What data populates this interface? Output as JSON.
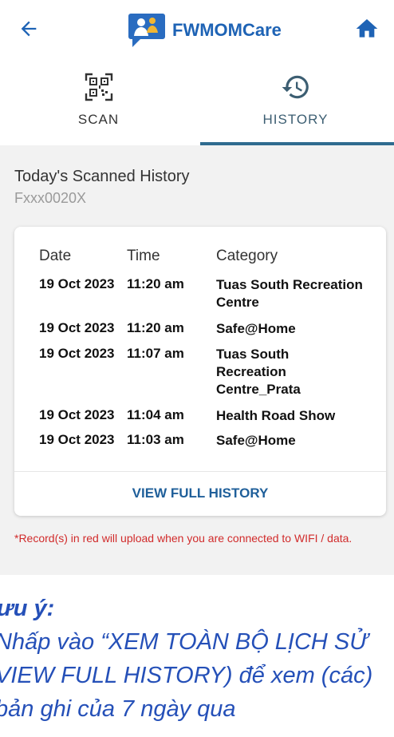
{
  "header": {
    "app_name": "FWMOMCare",
    "back_icon": "arrow-left-icon",
    "home_icon": "home-icon",
    "brand_color": "#1e63b5"
  },
  "tabs": [
    {
      "label": "SCAN",
      "icon": "qr-code-icon",
      "selected": false
    },
    {
      "label": "HISTORY",
      "icon": "history-icon",
      "selected": true
    }
  ],
  "history": {
    "title": "Today's Scanned History",
    "user_id": "Fxxx0020X",
    "columns": {
      "date": "Date",
      "time": "Time",
      "category": "Category"
    },
    "rows": [
      {
        "date": "19 Oct 2023",
        "time": "11:20 am",
        "category": "Tuas South Recreation Centre"
      },
      {
        "date": "19 Oct 2023",
        "time": "11:20 am",
        "category": "Safe@Home"
      },
      {
        "date": "19 Oct 2023",
        "time": "11:07 am",
        "category": "Tuas South Recreation Centre_Prata"
      },
      {
        "date": "19 Oct 2023",
        "time": "11:04 am",
        "category": "Health Road Show"
      },
      {
        "date": "19 Oct 2023",
        "time": "11:03 am",
        "category": "Safe@Home"
      }
    ],
    "view_full_label": "VIEW FULL HISTORY",
    "note": "*Record(s) in red will upload when you are connected to WIFI / data."
  },
  "annotation": {
    "title": "ưu ý:",
    "line1": "Nhấp vào “XEM TOÀN BỘ LỊCH SỬ",
    "line2": "VIEW FULL HISTORY) để xem (các)",
    "line3": "bản ghi của 7 ngày qua"
  }
}
